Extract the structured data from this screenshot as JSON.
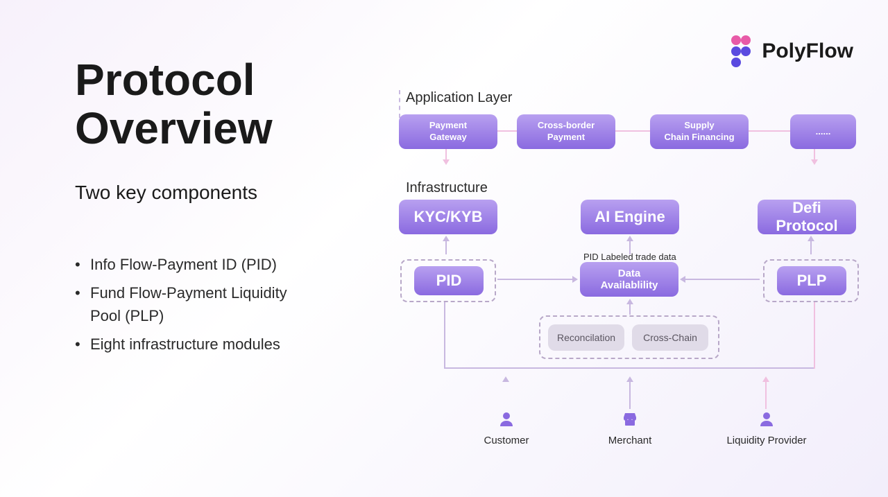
{
  "brand": "PolyFlow",
  "title_line1": "Protocol",
  "title_line2": "Overview",
  "subtitle": "Two key components",
  "bullets": [
    "Info Flow-Payment ID (PID)",
    "Fund Flow-Payment Liquidity Pool (PLP)",
    "Eight infrastructure modules"
  ],
  "section_labels": {
    "application": "Application Layer",
    "infrastructure": "Infrastructure"
  },
  "app_layer": [
    "Payment\nGateway",
    "Cross-border\nPayment",
    "Supply\nChain Financing",
    "......"
  ],
  "infra_row1": [
    "KYC/KYB",
    "AI Engine",
    "Defi Protocol"
  ],
  "infra_row2": {
    "pid": "PID",
    "da": "Data\nAvailablility",
    "plp": "PLP"
  },
  "da_note": "PID Labeled trade data",
  "sub_modules": [
    "Reconcilation",
    "Cross-Chain"
  ],
  "actors": [
    "Customer",
    "Merchant",
    "Liquidity Provider"
  ]
}
